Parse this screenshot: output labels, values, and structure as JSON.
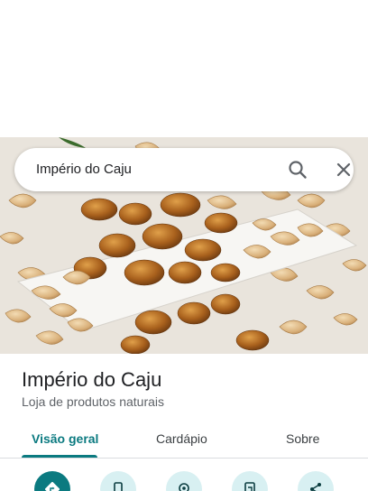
{
  "search": {
    "query": "Império do Caju"
  },
  "place": {
    "name": "Império do Caju",
    "category": "Loja de produtos naturais"
  },
  "tabs": [
    {
      "label": "Visão geral",
      "active": true
    },
    {
      "label": "Cardápio",
      "active": false
    },
    {
      "label": "Sobre",
      "active": false
    }
  ],
  "actions": [
    {
      "icon": "directions-icon",
      "primary": true
    },
    {
      "icon": "phone-icon",
      "primary": false
    },
    {
      "icon": "location-pin-icon",
      "primary": false
    },
    {
      "icon": "send-to-phone-icon",
      "primary": false
    },
    {
      "icon": "share-icon",
      "primary": false
    }
  ],
  "colors": {
    "accent": "#0b7a80",
    "action_bg": "#d8f0f2",
    "text_primary": "#202124",
    "text_secondary": "#5f6368"
  }
}
